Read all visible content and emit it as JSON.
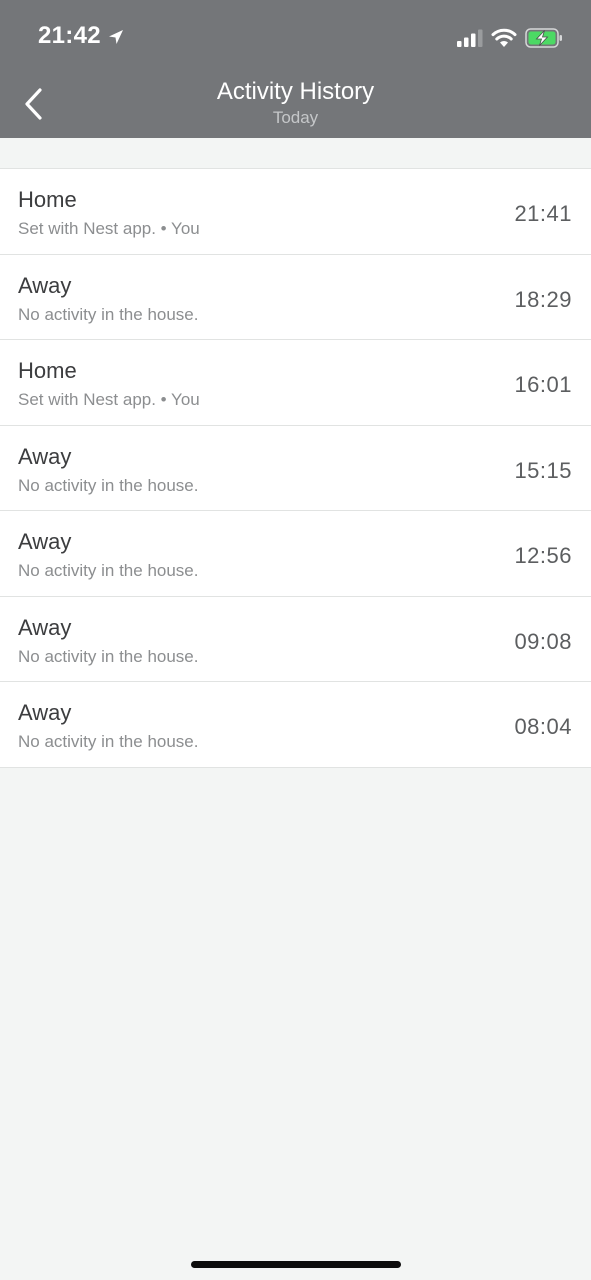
{
  "status_bar": {
    "time": "21:42",
    "icons": [
      "location-arrow-icon",
      "signal-icon",
      "wifi-icon",
      "battery-charging-icon"
    ]
  },
  "nav": {
    "back_icon": "chevron-left-icon",
    "title": "Activity History",
    "subtitle": "Today"
  },
  "activities": [
    {
      "title": "Home",
      "subtitle": "Set with Nest app. • You",
      "time": "21:41"
    },
    {
      "title": "Away",
      "subtitle": "No activity in the house.",
      "time": "18:29"
    },
    {
      "title": "Home",
      "subtitle": "Set with Nest app. • You",
      "time": "16:01"
    },
    {
      "title": "Away",
      "subtitle": "No activity in the house.",
      "time": "15:15"
    },
    {
      "title": "Away",
      "subtitle": "No activity in the house.",
      "time": "12:56"
    },
    {
      "title": "Away",
      "subtitle": "No activity in the house.",
      "time": "09:08"
    },
    {
      "title": "Away",
      "subtitle": "No activity in the house.",
      "time": "08:04"
    }
  ],
  "colors": {
    "header_bg": "#747679",
    "page_bg": "#f3f5f4",
    "row_bg": "#ffffff",
    "battery_fill": "#4cd964"
  }
}
